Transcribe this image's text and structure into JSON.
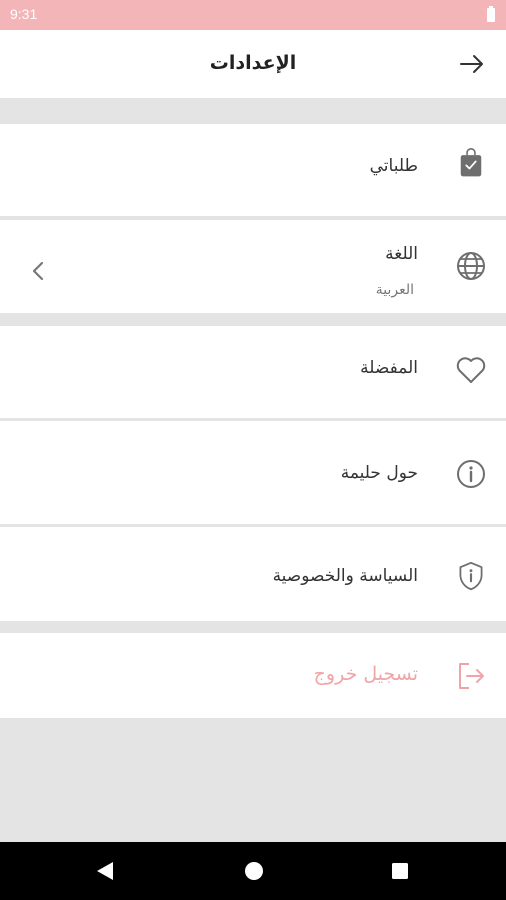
{
  "status_bar": {
    "time": "9:31"
  },
  "header": {
    "title": "الإعدادات",
    "back_icon": "arrow-right-icon"
  },
  "settings": {
    "orders": {
      "label": "طلباتي",
      "icon": "shopping-bag-icon"
    },
    "language": {
      "label": "اللغة",
      "value": "العربية",
      "icon": "globe-icon"
    },
    "favorites": {
      "label": "المفضلة",
      "icon": "heart-icon"
    },
    "about": {
      "label": "حول حليمة",
      "icon": "info-icon"
    },
    "privacy": {
      "label": "السياسة والخصوصية",
      "icon": "shield-info-icon"
    },
    "logout": {
      "label": "تسجيل خروج",
      "icon": "logout-icon"
    }
  },
  "colors": {
    "accent": "#f4b5b9",
    "logout": "#f1a4a8",
    "icon": "#6e6e6e"
  },
  "nav_bar": {
    "back": "back-triangle-icon",
    "home": "home-circle-icon",
    "recents": "recents-square-icon"
  }
}
